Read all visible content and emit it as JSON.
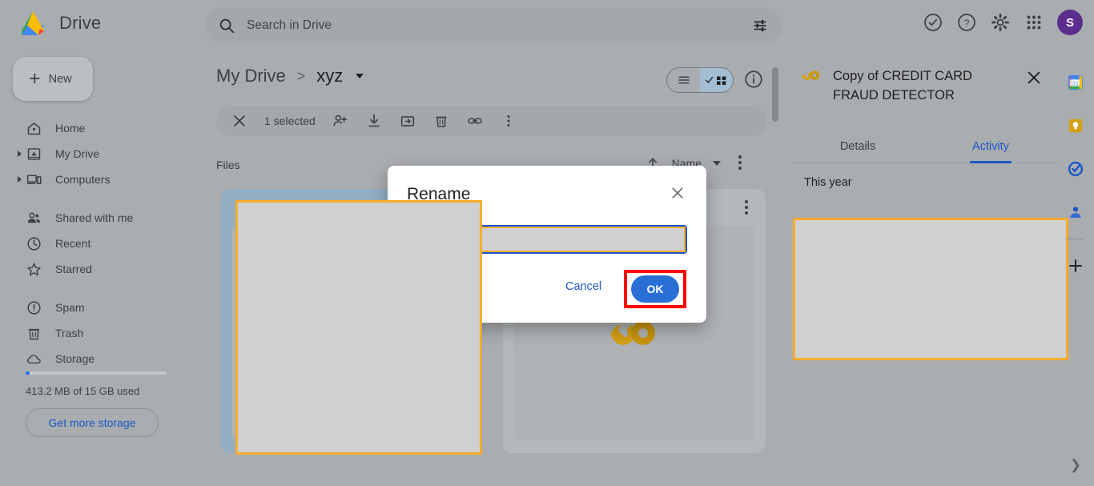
{
  "app": {
    "title": "Drive",
    "logo": "google-drive-logo"
  },
  "search": {
    "placeholder": "Search in Drive",
    "value": "",
    "icon": "search-icon",
    "filter_icon": "tune-icon"
  },
  "top_actions": [
    {
      "name": "active-status-icon",
      "label": "Active"
    },
    {
      "name": "help-icon",
      "label": "Support"
    },
    {
      "name": "gear-icon",
      "label": "Settings"
    },
    {
      "name": "apps-grid-icon",
      "label": "Google apps"
    }
  ],
  "avatar": {
    "initial": "S",
    "color": "#5b2d8e"
  },
  "sidebar": {
    "new_button": {
      "label": "New",
      "icon": "plus-icon"
    },
    "items": [
      {
        "label": "Home",
        "icon": "home-icon",
        "expandable": false
      },
      {
        "label": "My Drive",
        "icon": "my-drive-icon",
        "expandable": true
      },
      {
        "label": "Computers",
        "icon": "computers-icon",
        "expandable": true
      },
      {
        "label": "Shared with me",
        "icon": "people-icon",
        "expandable": false
      },
      {
        "label": "Recent",
        "icon": "clock-icon",
        "expandable": false
      },
      {
        "label": "Starred",
        "icon": "star-icon",
        "expandable": false
      },
      {
        "label": "Spam",
        "icon": "spam-icon",
        "expandable": false
      },
      {
        "label": "Trash",
        "icon": "trash-icon",
        "expandable": false
      },
      {
        "label": "Storage",
        "icon": "cloud-icon",
        "expandable": false
      }
    ],
    "storage": {
      "usage_text": "413.2 MB of 15 GB used",
      "percent": 3,
      "cta_label": "Get more storage"
    }
  },
  "breadcrumb": {
    "root": "My Drive",
    "separator": ">",
    "current": "xyz"
  },
  "view_toggle": {
    "list_label": "list-view",
    "grid_label": "grid-view",
    "active": "grid"
  },
  "info_button": {
    "name": "info-icon"
  },
  "selection_bar": {
    "close_label": "close-selection",
    "count_text": "1 selected",
    "actions": [
      {
        "name": "share-icon",
        "label": "Share"
      },
      {
        "name": "download-icon",
        "label": "Download"
      },
      {
        "name": "move-to-folder-icon",
        "label": "Move"
      },
      {
        "name": "trash-icon",
        "label": "Remove"
      },
      {
        "name": "link-icon",
        "label": "Get link"
      },
      {
        "name": "more-vert-icon",
        "label": "More actions"
      }
    ]
  },
  "files_section": {
    "heading": "Files",
    "sort": {
      "direction_icon": "arrow-up-icon",
      "label": "Name",
      "caret": "chevron-down-icon"
    },
    "more_icon": "more-vert-icon",
    "cards": [
      {
        "name": "file-card-selected",
        "selected": true,
        "redacted": true,
        "thumb_icon": ""
      },
      {
        "name": "file-card-colab",
        "selected": false,
        "redacted": false,
        "thumb_icon": "colab-co-icon"
      }
    ]
  },
  "details_panel": {
    "file_icon": "colab-co-icon",
    "title": "Copy of CREDIT CARD FRAUD DETECTOR",
    "close_icon": "close-icon",
    "tabs": [
      {
        "label": "Details",
        "active": false
      },
      {
        "label": "Activity",
        "active": true
      }
    ],
    "section_heading": "This year",
    "redacted_block": true
  },
  "right_rail": {
    "items": [
      {
        "name": "google-calendar-icon",
        "label": "Calendar",
        "badge": "31"
      },
      {
        "name": "google-keep-icon",
        "label": "Keep"
      },
      {
        "name": "google-tasks-icon",
        "label": "Tasks"
      },
      {
        "name": "google-contacts-icon",
        "label": "Contacts"
      },
      {
        "name": "add-apps-icon",
        "label": "Get add-ons"
      }
    ],
    "expand_icon": "chevron-right-icon"
  },
  "rename_dialog": {
    "title": "Rename",
    "close_icon": "close-icon",
    "input_value": "",
    "cancel_label": "Cancel",
    "ok_label": "OK",
    "ok_highlight_color": "#ff0000",
    "input_highlight_color": "#f9ab2e",
    "focus_color": "#1a56c4"
  }
}
